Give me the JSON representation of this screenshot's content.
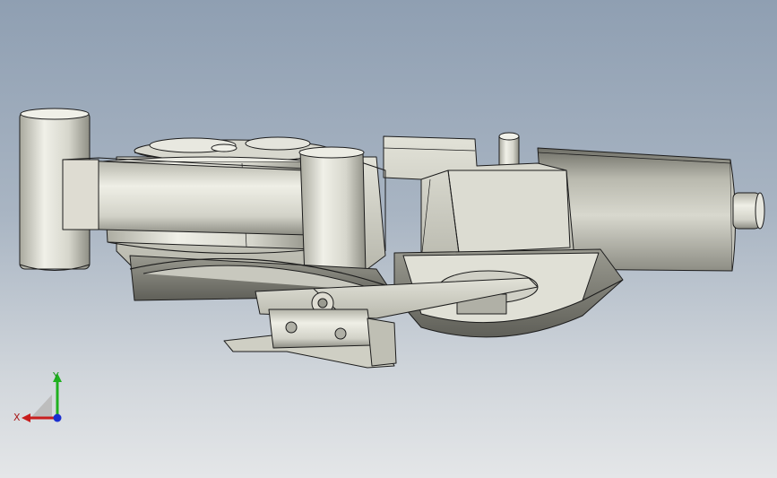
{
  "viewport": {
    "background_top": "#8f9fb2",
    "background_bottom": "#e4e6e8"
  },
  "model": {
    "part_color": "#cfcfc4",
    "edge_color": "#1c1c1c"
  },
  "triad": {
    "x_label": "X",
    "y_label": "Y",
    "x_color": "#c81e1e",
    "y_color": "#1fb01f",
    "z_color": "#1a2fd0"
  }
}
